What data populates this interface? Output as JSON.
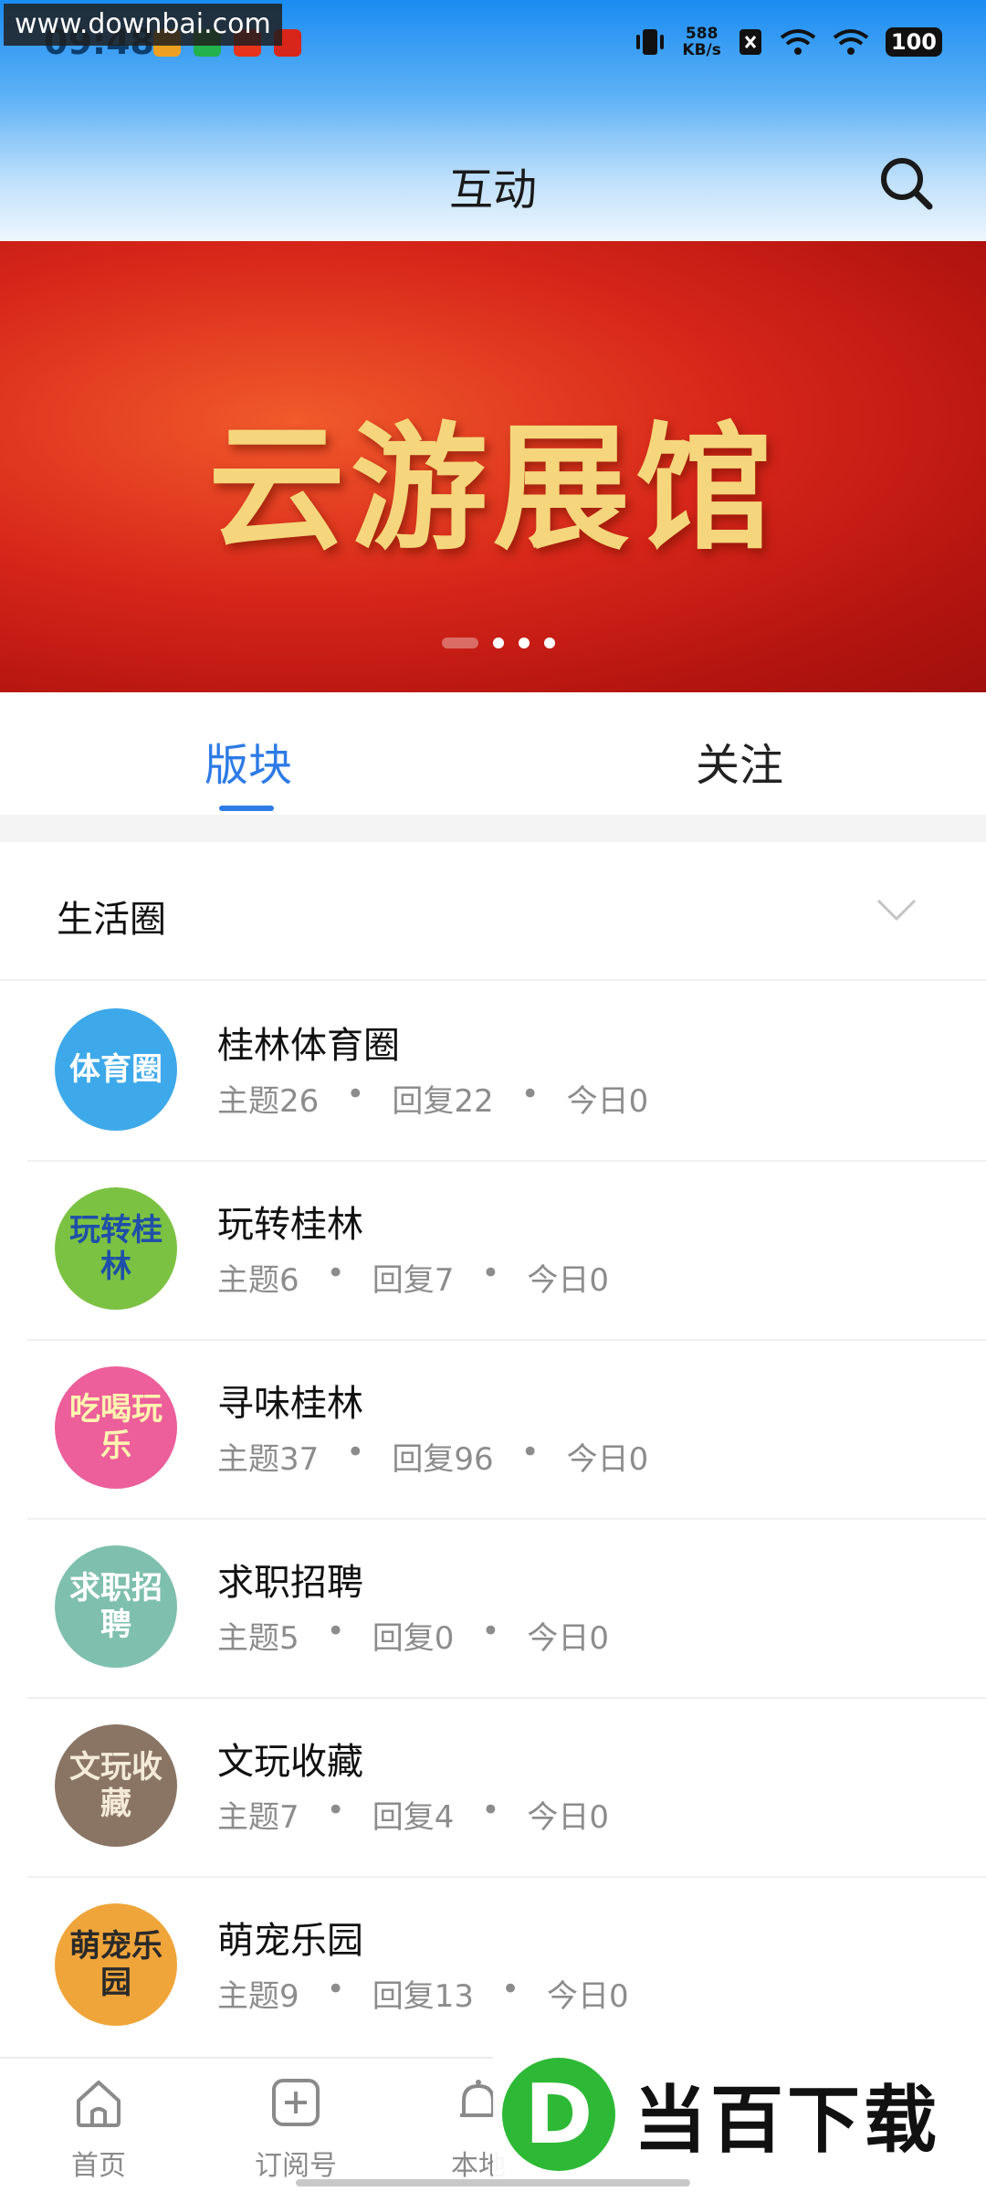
{
  "watermark": "www.downbai.com",
  "status_bar": {
    "time": "09:48",
    "net_speed_value": "588",
    "net_speed_unit": "KB/s",
    "battery": "100"
  },
  "header": {
    "title": "互动"
  },
  "banner": {
    "title": "云游展馆"
  },
  "tabs": [
    {
      "label": "版块"
    },
    {
      "label": "关注"
    }
  ],
  "section": {
    "title": "生活圈"
  },
  "forums": [
    {
      "name": "桂林体育圈",
      "topics": "主题26",
      "replies": "回复22",
      "today": "今日0",
      "avatar_text": "体育圈",
      "avatar_bg": "#3ea9ea",
      "avatar_fg": "#ffffff"
    },
    {
      "name": "玩转桂林",
      "topics": "主题6",
      "replies": "回复7",
      "today": "今日0",
      "avatar_text": "玩转桂林",
      "avatar_bg": "#7cc242",
      "avatar_fg": "#1f4fa8"
    },
    {
      "name": "寻味桂林",
      "topics": "主题37",
      "replies": "回复96",
      "today": "今日0",
      "avatar_text": "吃喝玩乐",
      "avatar_bg": "#ec5f9a",
      "avatar_fg": "#fff5b0"
    },
    {
      "name": "求职招聘",
      "topics": "主题5",
      "replies": "回复0",
      "today": "今日0",
      "avatar_text": "求职招聘",
      "avatar_bg": "#7fbfae",
      "avatar_fg": "#ffffff"
    },
    {
      "name": "文玩收藏",
      "topics": "主题7",
      "replies": "回复4",
      "today": "今日0",
      "avatar_text": "文玩收藏",
      "avatar_bg": "#8a7565",
      "avatar_fg": "#f4ead8"
    },
    {
      "name": "萌宠乐园",
      "topics": "主题9",
      "replies": "回复13",
      "today": "今日0",
      "avatar_text": "萌宠乐园",
      "avatar_bg": "#f0a53a",
      "avatar_fg": "#2a2a2a"
    }
  ],
  "separator": "•",
  "bottom_nav": [
    {
      "label": "首页",
      "icon": "home-icon"
    },
    {
      "label": "订阅号",
      "icon": "subscribe-plus-icon"
    },
    {
      "label": "本地",
      "icon": "bell-icon"
    }
  ],
  "brand_watermark": {
    "letter": "D",
    "text": "当百下载"
  },
  "colors": {
    "accent": "#2d7be6",
    "banner_red": "#d7261a",
    "gold_text": "#f6d67c",
    "muted_text": "#8c8c8c"
  }
}
